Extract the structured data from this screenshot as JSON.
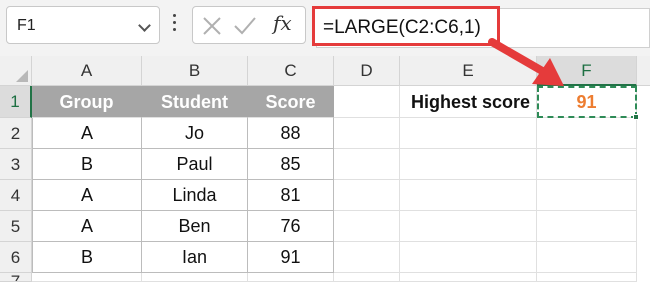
{
  "formula_bar": {
    "name_box": "F1",
    "fx_label": "fx",
    "formula": "=LARGE(C2:C6,1)"
  },
  "columns": [
    "A",
    "B",
    "C",
    "D",
    "E",
    "F"
  ],
  "rows": [
    "1",
    "2",
    "3",
    "4",
    "5",
    "6",
    "7"
  ],
  "table": {
    "headers": [
      "Group",
      "Student",
      "Score"
    ],
    "rows": [
      [
        "A",
        "Jo",
        "88"
      ],
      [
        "B",
        "Paul",
        "85"
      ],
      [
        "A",
        "Linda",
        "81"
      ],
      [
        "A",
        "Ben",
        "76"
      ],
      [
        "B",
        "Ian",
        "91"
      ]
    ]
  },
  "result": {
    "label": "Highest score",
    "value": "91"
  },
  "colors": {
    "header_fill": "#a6a6a6",
    "result_text": "#ed7d31",
    "highlight_red": "#e53b3b",
    "excel_green": "#217346"
  },
  "icons": [
    "chevron-down-icon",
    "more-icon",
    "cancel-icon",
    "enter-check-icon",
    "insert-function-icon",
    "arrow-icon"
  ]
}
